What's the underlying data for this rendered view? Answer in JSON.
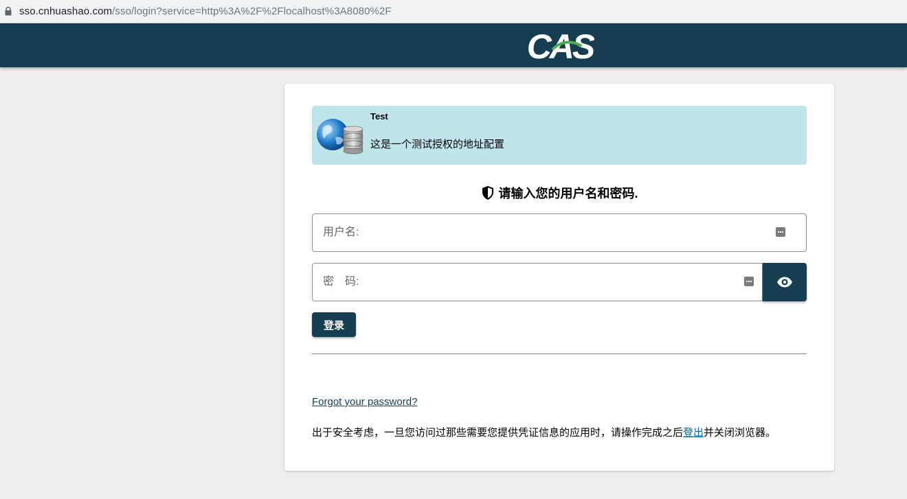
{
  "browser": {
    "url_host": "sso.cnhuashao.com",
    "url_path": "/sso/login?service=http%3A%2F%2Flocalhost%3A8080%2F"
  },
  "header": {
    "logo_text": "CAS",
    "background": "#153e50"
  },
  "service": {
    "title": "Test",
    "description": "这是一个测试授权的地址配置",
    "icon": "globe-database-icon"
  },
  "login": {
    "heading": "请输入您的用户名和密码.",
    "username_placeholder": "用户名:",
    "password_placeholder": "密　码:",
    "submit_label": "登录",
    "forgot_label": "Forgot your password?",
    "notice_before": "出于安全考虑，一旦您访问过那些需要您提供凭证信息的应用时，请操作完成之后",
    "notice_link": "登出",
    "notice_after": "并关闭浏览器。"
  },
  "colors": {
    "primary": "#153e50",
    "service_bg": "#bfe5eb",
    "page_bg": "#eeeeee"
  }
}
